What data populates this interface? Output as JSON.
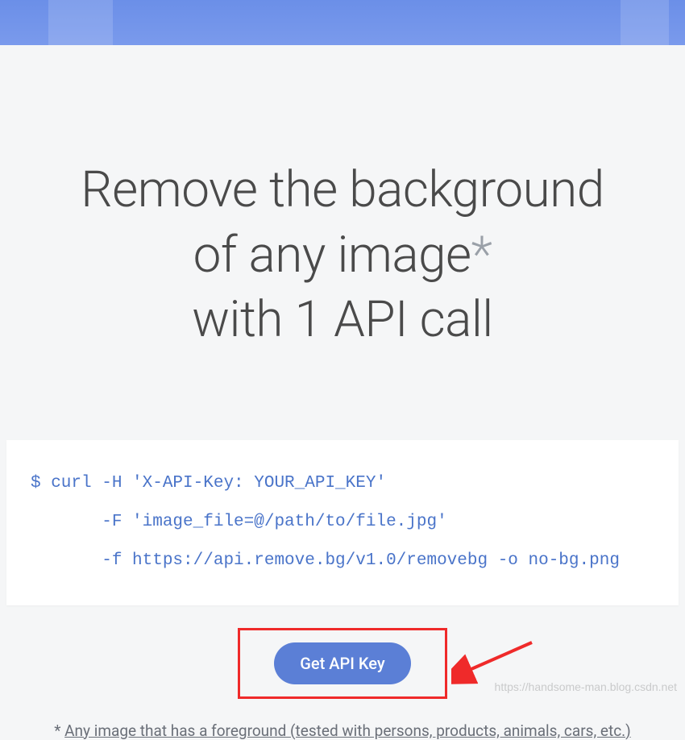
{
  "headline": {
    "line1": "Remove the background",
    "line2a": "of any image",
    "asterisk": "*",
    "line3": "with 1 API call"
  },
  "code": {
    "line1": "$ curl -H 'X-API-Key: YOUR_API_KEY'",
    "line2": "       -F 'image_file=@/path/to/file.jpg'",
    "line3": "       -f https://api.remove.bg/v1.0/removebg -o no-bg.png"
  },
  "button": {
    "label": "Get API Key"
  },
  "footnote": {
    "star": "* ",
    "text": "Any image that has a foreground (tested with persons, products, animals, cars, etc.)"
  },
  "watermark": "https://handsome-man.blog.csdn.net"
}
